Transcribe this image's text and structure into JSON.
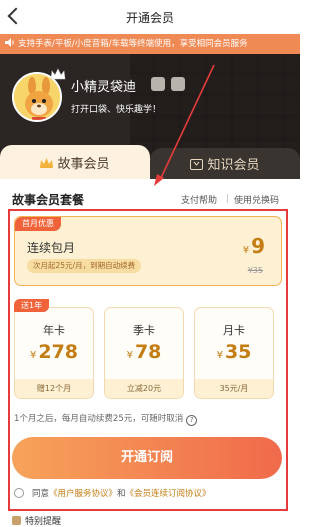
{
  "nav": {
    "title": "开通会员"
  },
  "notice": {
    "text": "支持手表/平板/小度音箱/车载等终端使用，享受相同会员服务"
  },
  "profile": {
    "username": "小精灵袋迪",
    "slogan": "打开口袋、快乐趣学！"
  },
  "tabs": [
    {
      "label": "故事会员",
      "active": true
    },
    {
      "label": "知识会员",
      "active": false
    }
  ],
  "section": {
    "title": "故事会员套餐",
    "help_link": "支付帮助",
    "redeem_link": "使用兑换码"
  },
  "monthly_plan": {
    "tag": "首月优惠",
    "name": "连续包月",
    "note": "次月起25元/月，到期自动续费",
    "currency": "¥",
    "price": "9",
    "original_price": "¥35"
  },
  "promo_tag": "送1年",
  "plans": [
    {
      "name": "年卡",
      "currency": "¥",
      "price": "278",
      "footer": "赠12个月"
    },
    {
      "name": "季卡",
      "currency": "¥",
      "price": "78",
      "footer": "立减20元"
    },
    {
      "name": "月卡",
      "currency": "¥",
      "price": "35",
      "footer": "35元/月"
    }
  ],
  "renew_note": "1个月之后，每月自动续费25元，可随时取消",
  "help_icon_text": "?",
  "subscribe_button": "开通订阅",
  "agreement": {
    "prefix": "同意",
    "link1": "《用户服务协议》",
    "middle": "和",
    "link2": "《会员连续订阅协议》"
  },
  "special_notice": "特别提醒",
  "colors": {
    "accent_orange": "#f06a4b",
    "gold_text": "#c47d12",
    "annotation_red": "#e53b3b",
    "header_dark": "#2b2624"
  }
}
